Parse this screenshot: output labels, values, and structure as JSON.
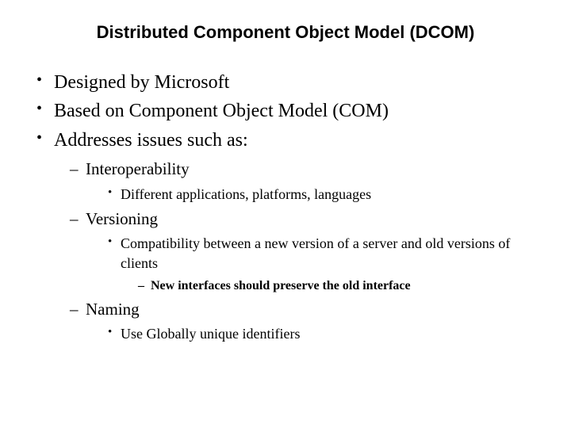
{
  "title": "Distributed Component Object Model (DCOM)",
  "bullets": {
    "b1": "Designed by Microsoft",
    "b2": "Based on Component Object Model (COM)",
    "b3": "Addresses issues such as:",
    "b3_1": "Interoperability",
    "b3_1_1": "Different applications, platforms, languages",
    "b3_2": "Versioning",
    "b3_2_1": "Compatibility between a new version of a server and old versions of clients",
    "b3_2_1_1": "New interfaces should preserve the old interface",
    "b3_3": "Naming",
    "b3_3_1": "Use Globally unique identifiers"
  }
}
